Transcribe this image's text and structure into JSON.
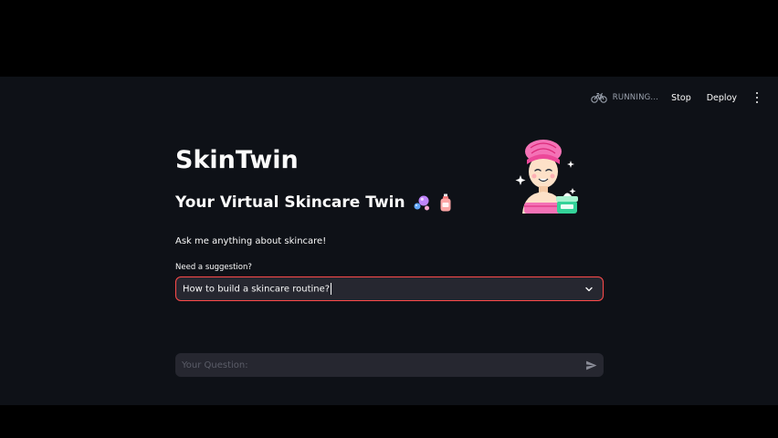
{
  "toolbar": {
    "status": "RUNNING...",
    "stop_label": "Stop",
    "deploy_label": "Deploy",
    "menu_icon": "more-vertical-icon",
    "status_icon": "bicycle-icon"
  },
  "page": {
    "title": "SkinTwin",
    "subtitle": "Your Virtual Skincare Twin",
    "subtitle_icons": [
      "soap-bubbles-icon",
      "lotion-bottle-icon"
    ],
    "intro": "Ask me anything about skincare!",
    "hero_icon": "face-mask-woman-icon"
  },
  "suggestion": {
    "label": "Need a suggestion?",
    "selected": "How to build a skincare routine?",
    "dropdown_icon": "chevron-down-icon"
  },
  "chat": {
    "placeholder": "Your Question:",
    "value": "",
    "send_icon": "send-icon"
  },
  "colors": {
    "background": "#0e1117",
    "surface": "#262730",
    "accent": "#ff4b4b",
    "text": "#fafafa"
  }
}
